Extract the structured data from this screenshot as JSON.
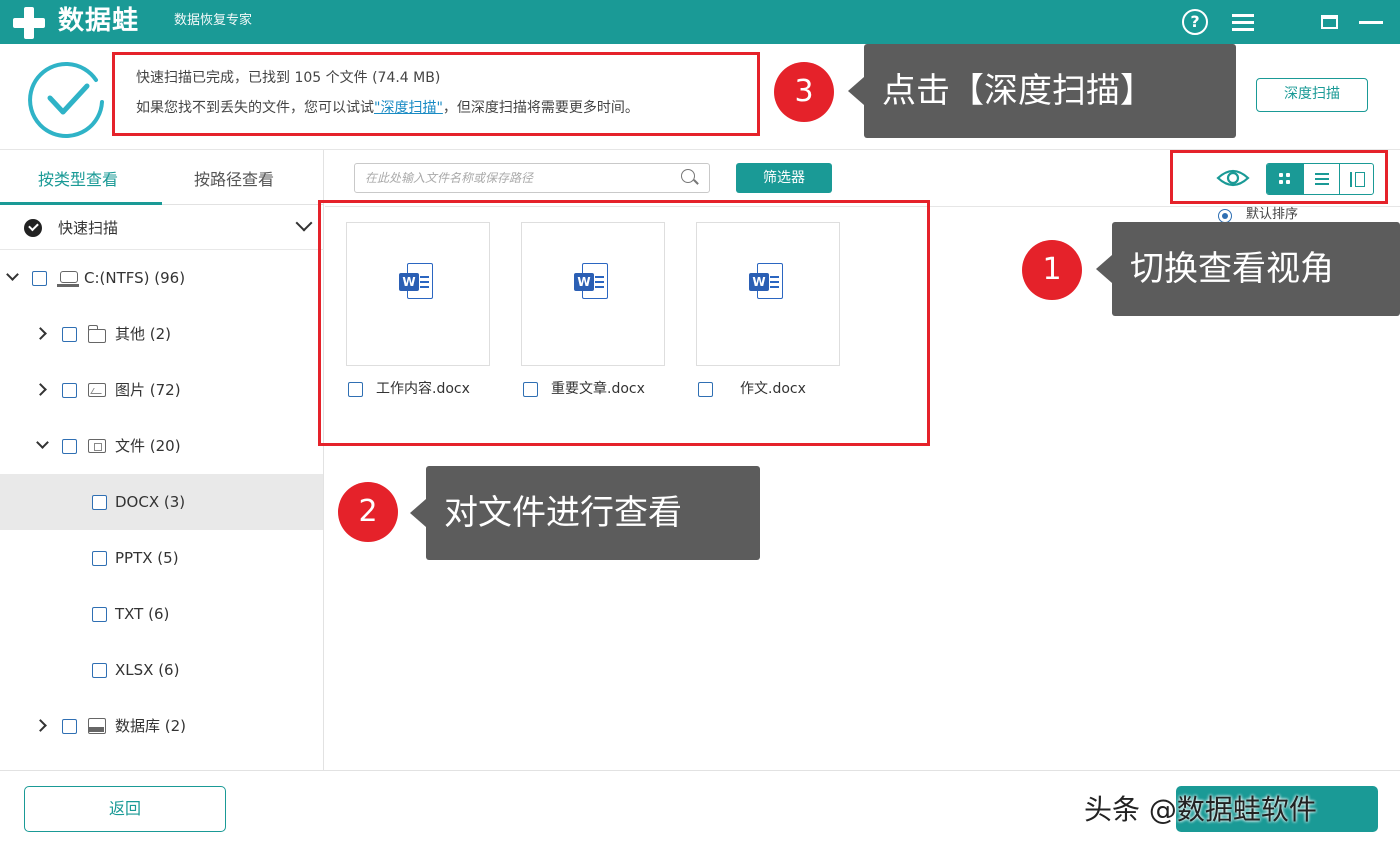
{
  "app": {
    "name": "数据蛙",
    "subtitle": "数据恢复专家",
    "help_glyph": "?"
  },
  "status": {
    "line1": "快速扫描已完成，已找到 105 个文件 (74.4 MB)",
    "line2_prefix": "如果您找不到丢失的文件，您可以试试",
    "line2_link": "\"深度扫描\"",
    "line2_suffix": "，但深度扫描将需要更多时间。",
    "deep_scan_button": "深度扫描"
  },
  "sidebar": {
    "tabs": [
      {
        "label": "按类型查看",
        "active": true
      },
      {
        "label": "按路径查看",
        "active": false
      }
    ],
    "quick_scan_label": "快速扫描",
    "tree": [
      {
        "label": "C:(NTFS) (96)",
        "icon": "disk-icon",
        "expanded": true
      },
      {
        "label": "其他 (2)",
        "icon": "folder-icon",
        "expanded": false
      },
      {
        "label": "图片 (72)",
        "icon": "image-icon",
        "expanded": false
      },
      {
        "label": "文件 (20)",
        "icon": "document-icon",
        "expanded": true
      },
      {
        "label": "DOCX (3)",
        "selected": true
      },
      {
        "label": "PPTX (5)"
      },
      {
        "label": "TXT (6)"
      },
      {
        "label": "XLSX (6)"
      },
      {
        "label": "数据库 (2)",
        "icon": "database-icon",
        "expanded": false
      }
    ]
  },
  "content": {
    "search_placeholder": "在此处输入文件名称或保存路径",
    "filter_button": "筛选器",
    "sort_label": "默认排序",
    "files": [
      {
        "name": "工作内容.docx",
        "badge": "W"
      },
      {
        "name": "重要文章.docx",
        "badge": "W"
      },
      {
        "name": "作文.docx",
        "badge": "W"
      }
    ]
  },
  "footer": {
    "back_button": "返回",
    "watermark": "头条 @数据蛙软件"
  },
  "annotations": [
    {
      "number": "1",
      "text": "切换查看视角"
    },
    {
      "number": "2",
      "text": "对文件进行查看"
    },
    {
      "number": "3",
      "text": "点击【深度扫描】"
    }
  ],
  "colors": {
    "accent": "#1a9a96",
    "annotation_red": "#e5222a",
    "callout_gray": "#5c5c5c",
    "word_blue": "#2b5fb4"
  }
}
